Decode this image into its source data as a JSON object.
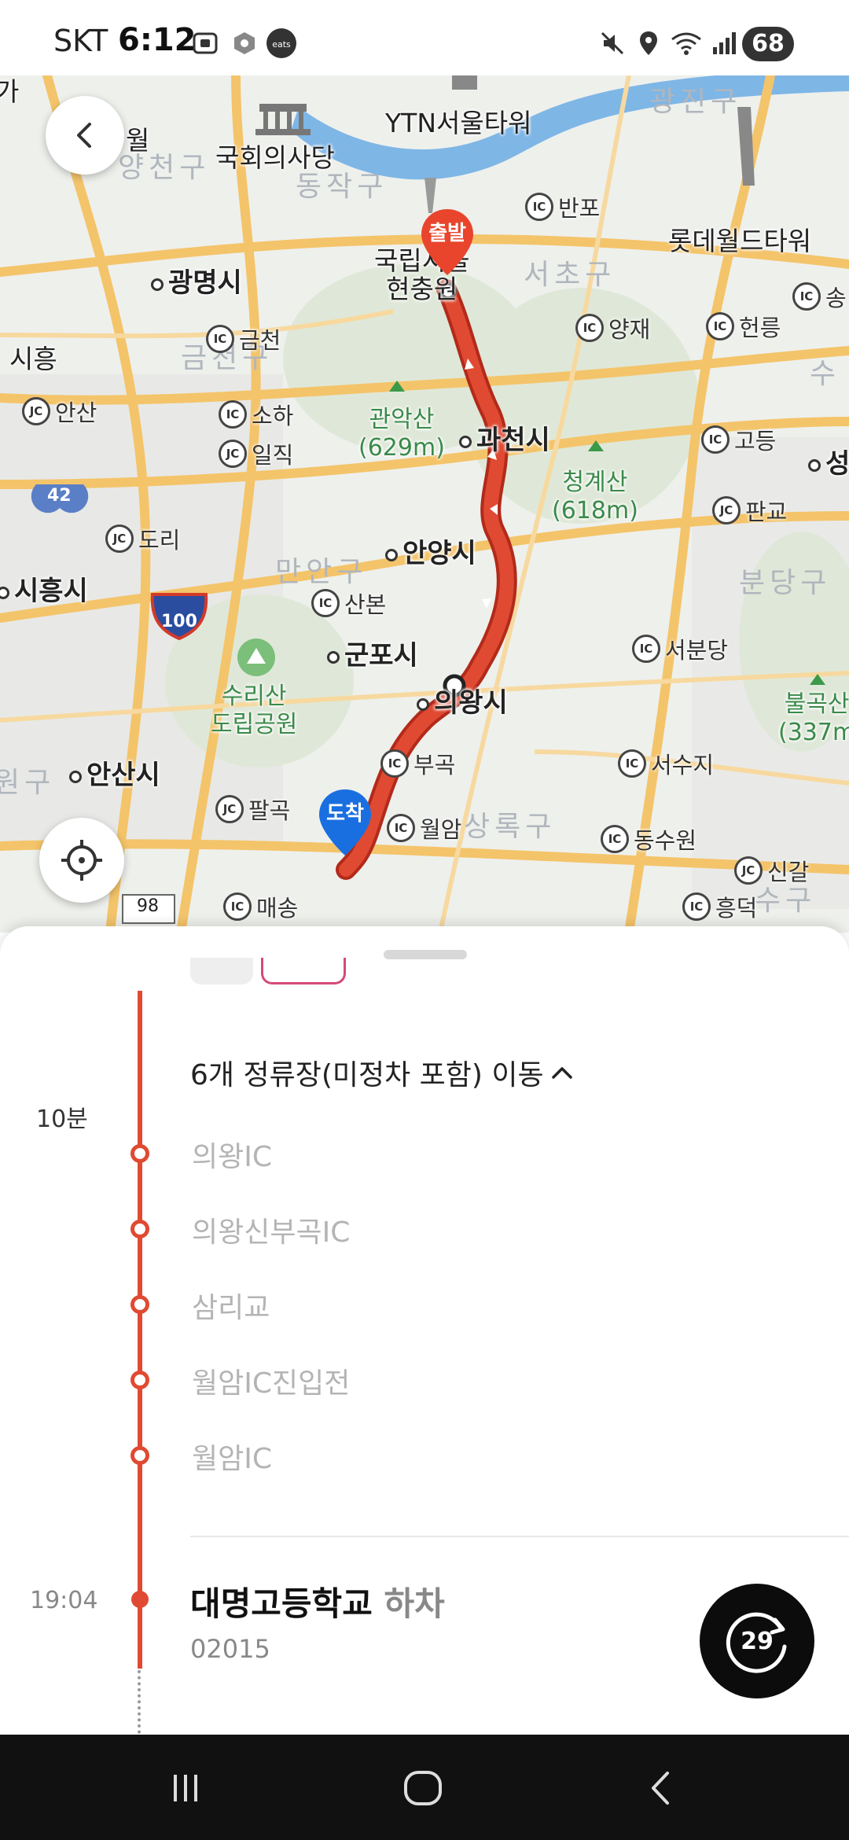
{
  "status_bar": {
    "carrier": "SKT",
    "time": "6:12",
    "battery": "68",
    "left_icons": [
      "screenshot-icon",
      "app-notification-icon",
      "coupang-eats-icon"
    ],
    "right_icons": [
      "mute-icon",
      "location-icon",
      "wifi-icon",
      "signal-icon"
    ]
  },
  "map": {
    "origin_pin": "출발",
    "destination_pin": "도착",
    "route_color": "#e04a32",
    "river_color": "#7eb6e6",
    "highway_color": "#f4c46a",
    "labels": {
      "ytn": "YTN서울타워",
      "assembly": "국회의사당",
      "lotte": "롯데월드타워",
      "cemetery": "국립서울\n현충원",
      "gwangmyeong": "광명시",
      "gwacheon": "과천시",
      "anyang": "안양시",
      "gunpo": "군포시",
      "uiwang": "의왕시",
      "siheung": "시흥시",
      "ansan": "안산시",
      "gwanaksan": "관악산\n(629m)",
      "cheonggyesan": "청계산\n(618m)",
      "bulgoksan": "불곡산\n(337m",
      "surisan": "수리산\n도립공원",
      "frag_wol": "월",
      "frag_si": "시흥",
      "frag_ga": "가"
    },
    "districts": {
      "gwangjin": "광진구",
      "yangcheon": "양천구",
      "dongjak": "동작구",
      "seocho": "서초구",
      "geumcheon": "금천구",
      "manan": "만안구",
      "bundang": "분당구",
      "sujeong": "수",
      "danwon": "원구",
      "sangrok": "상록구",
      "suji": "수구"
    },
    "ic": {
      "banpo": "반포",
      "yangjae": "양재",
      "heolleung": "헌릉",
      "song": "송",
      "geumcheon": "금천",
      "soha": "소하",
      "godeung": "고등",
      "sanbon": "산본",
      "seobundang": "서분당",
      "bugok": "부곡",
      "seosuji": "서수지",
      "wolam": "월암",
      "dongsuwon": "동수원",
      "maesong": "매송",
      "heungdeok": "흥덕"
    },
    "jc": {
      "ansan": "안산",
      "ilik": "일직",
      "dori": "도리",
      "pangyo": "판교",
      "palgok": "팔곡",
      "singal": "신갈"
    },
    "roads": {
      "r42": "42",
      "r100": "100",
      "r98": "98",
      "seong": "성"
    }
  },
  "sheet": {
    "stops_summary": "6개 정류장(미정차 포함) 이동",
    "duration": "10분",
    "stops": [
      "의왕IC",
      "의왕신부곡IC",
      "삼리교",
      "월암IC진입전",
      "월암IC"
    ],
    "arrival_time": "19:04",
    "arrival_stop": "대명고등학교",
    "arrival_action": " 하차",
    "arrival_code": "02015",
    "refresh_countdown": "29"
  }
}
